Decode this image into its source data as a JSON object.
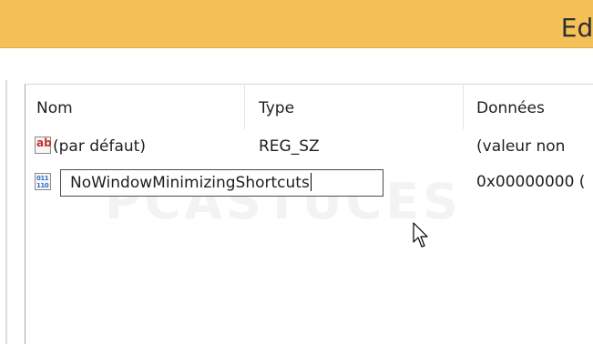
{
  "window": {
    "title": "Edi"
  },
  "columns": {
    "name": "Nom",
    "type": "Type",
    "data": "Données"
  },
  "rows": [
    {
      "icon": "string-value-icon",
      "icon_glyph": "ab",
      "name": "(par défaut)",
      "type": "REG_SZ",
      "data": "(valeur non"
    },
    {
      "icon": "binary-value-icon",
      "icon_glyph": "011 110",
      "name": "NoWindowMinimizingShortcuts",
      "type": "",
      "data": "0x00000000 ("
    }
  ],
  "editing": {
    "row": 1,
    "value": "NoWindowMinimizingShortcuts"
  },
  "watermark": "PCASTUCES",
  "colors": {
    "titlebar": "#f4c158",
    "text": "#1e1e1e",
    "string_icon": "#c4312b",
    "binary_icon": "#2a6fd0"
  }
}
